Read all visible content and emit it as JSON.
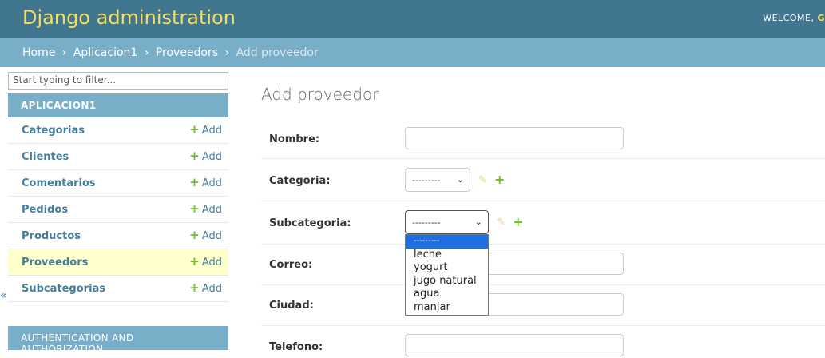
{
  "header": {
    "brand": "Django administration",
    "welcome": "WELCOME, ",
    "username_initial": "G"
  },
  "breadcrumbs": {
    "home": "Home",
    "app": "Aplicacion1",
    "model": "Proveedors",
    "current": "Add proveedor",
    "separator": "›"
  },
  "sidebar": {
    "filter_placeholder": "Start typing to filter...",
    "module_title": "APLICACION1",
    "add_label": "Add",
    "items": [
      {
        "label": "Categorias"
      },
      {
        "label": "Clientes"
      },
      {
        "label": "Comentarios"
      },
      {
        "label": "Pedidos"
      },
      {
        "label": "Productos"
      },
      {
        "label": "Proveedors"
      },
      {
        "label": "Subcategorias"
      }
    ],
    "auth_title": "AUTHENTICATION AND AUTHORIZATION",
    "collapse_icon": "«"
  },
  "form": {
    "title": "Add proveedor",
    "fields": {
      "nombre": {
        "label": "Nombre:",
        "value": ""
      },
      "categoria": {
        "label": "Categoria:",
        "selected": "---------"
      },
      "subcategoria": {
        "label": "Subcategoria:",
        "selected": "---------"
      },
      "correo": {
        "label": "Correo:",
        "value": ""
      },
      "ciudad": {
        "label": "Ciudad:",
        "value": ""
      },
      "telefono": {
        "label": "Telefono:",
        "value": ""
      }
    },
    "subcategoria_options": [
      "---------",
      "leche",
      "yogurt",
      "jugo natural",
      "agua",
      "manjar"
    ]
  },
  "icons": {
    "pencil": "pencil-icon",
    "plus": "plus-icon"
  },
  "colors": {
    "header_bg": "#417690",
    "brand_text": "#f5dd5d",
    "breadcrumb_bg": "#79aec8",
    "add_green": "#70bf2b",
    "current_row": "#ffffcc",
    "selected_option": "#1e6fe0"
  }
}
